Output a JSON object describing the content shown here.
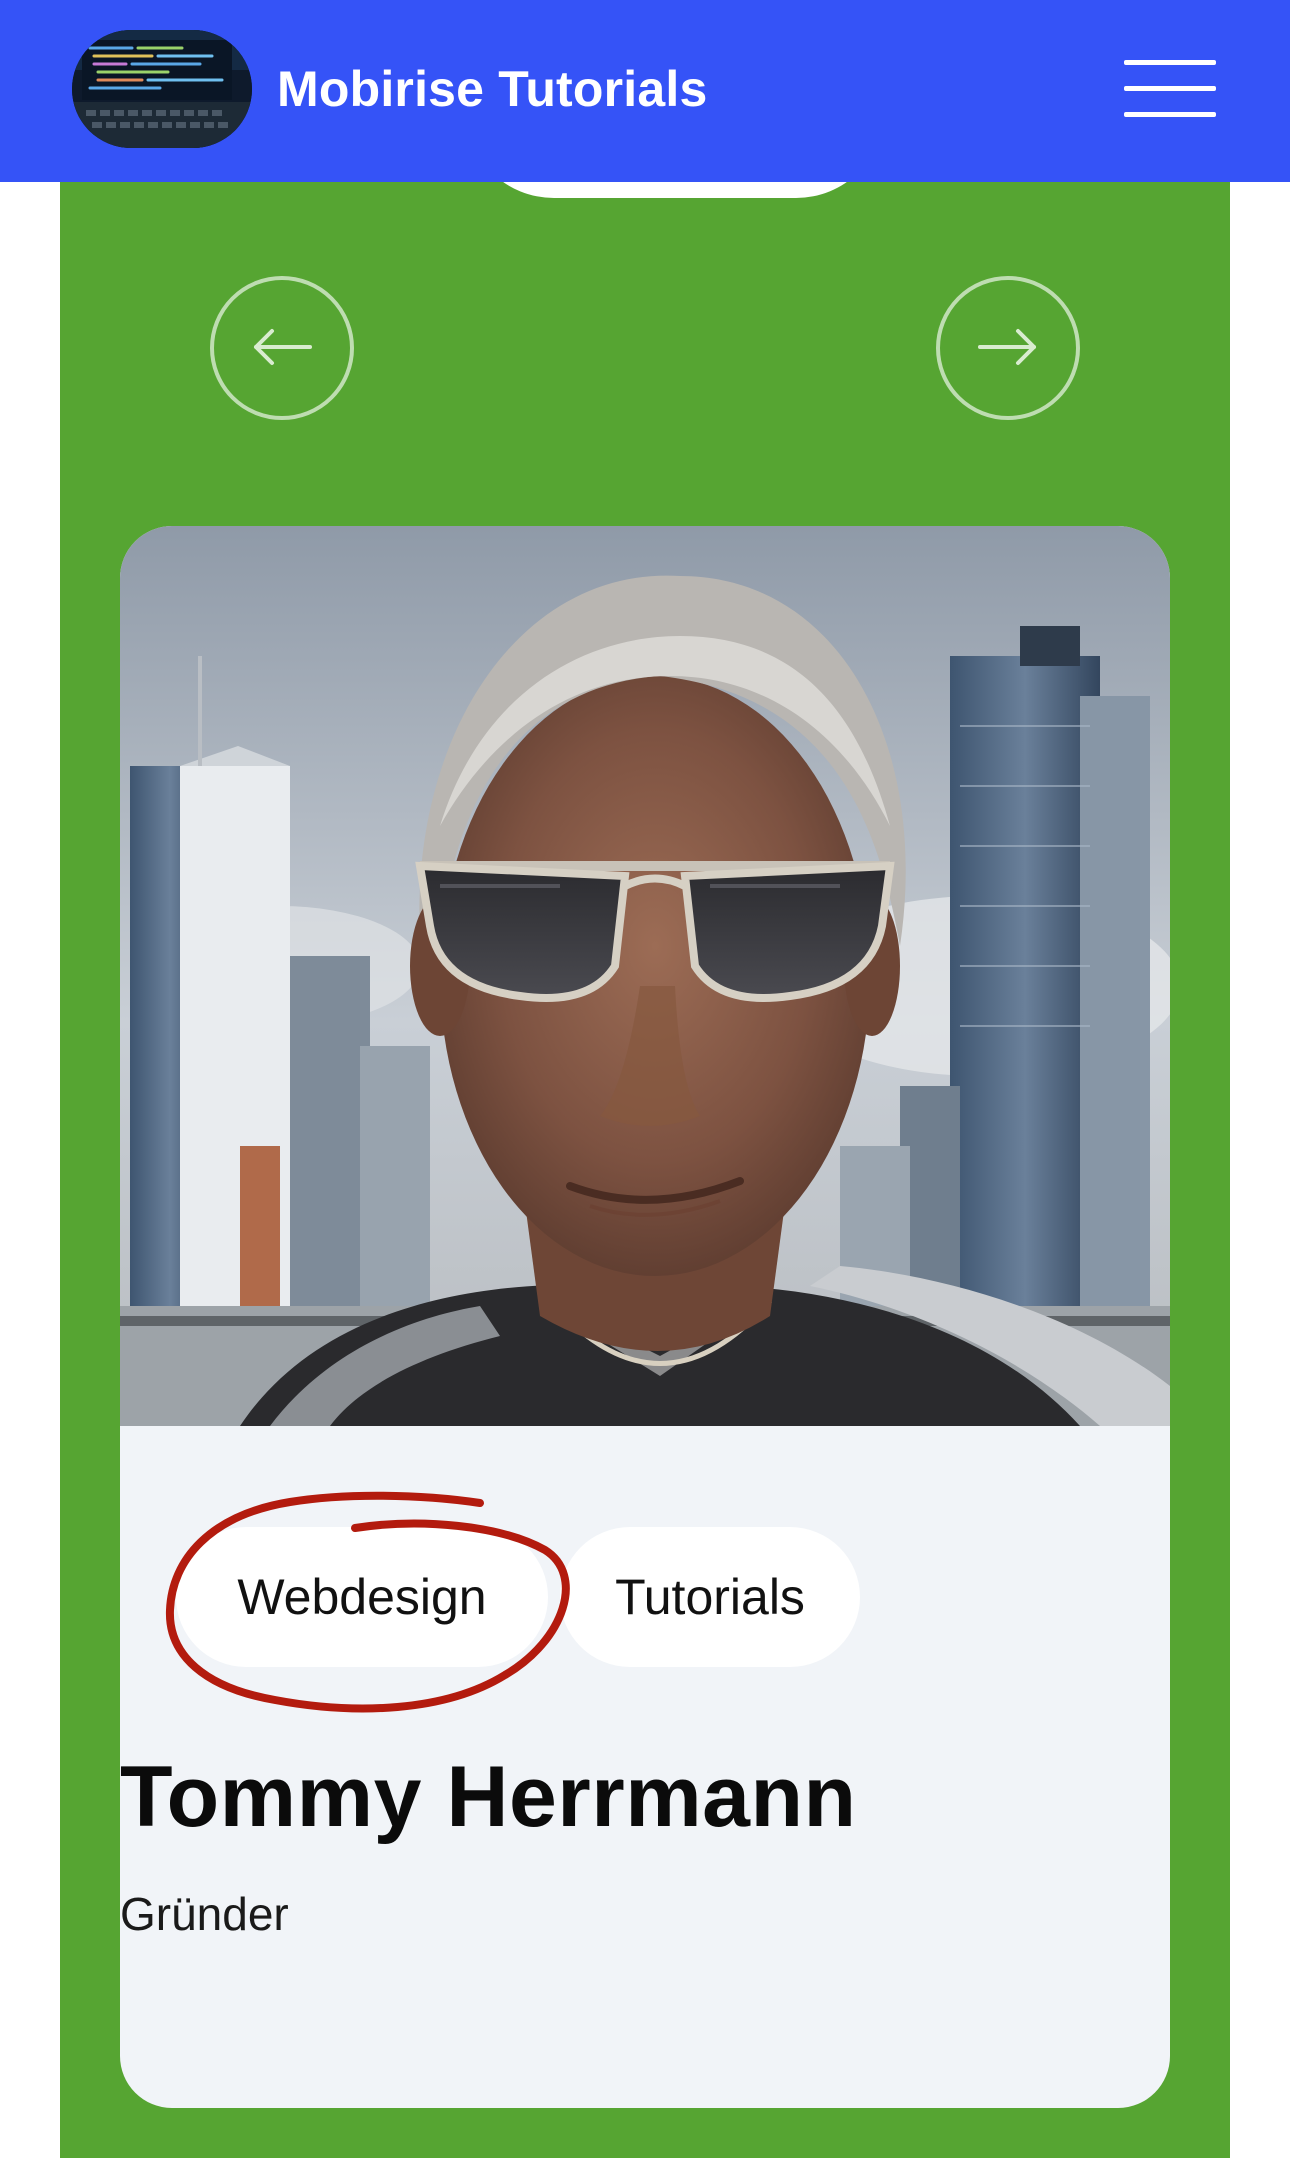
{
  "header": {
    "brand": "Mobirise Tutorials",
    "background_color": "#3553f7",
    "logo_icon": "code-screen-logo",
    "menu_icon": "hamburger-menu-icon"
  },
  "section": {
    "background_color": "#56a532",
    "prev_icon": "arrow-left-icon",
    "next_icon": "arrow-right-icon"
  },
  "card": {
    "photo": "portrait-man-sunglasses-city-skyline",
    "tags": [
      "Webdesign",
      "Tutorials"
    ],
    "name": "Tommy Herrmann",
    "role": "Gründer",
    "annotation_color": "#b31b0e"
  }
}
